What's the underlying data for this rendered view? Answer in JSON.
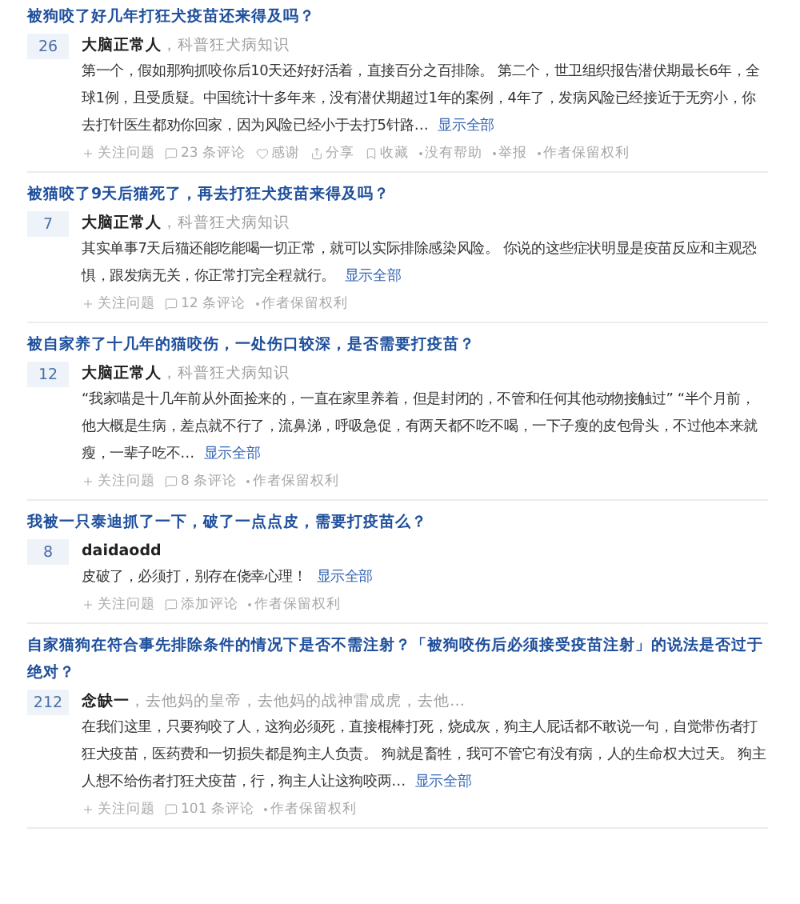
{
  "answers": [
    {
      "question": "被狗咬了好几年打狂犬疫苗还来得及吗？",
      "votes": "26",
      "author": "大脑正常人",
      "bio": "，科普狂犬病知识",
      "excerpt": "第一个，假如那狗抓咬你后10天还好好活着，直接百分之百排除。 第二个，世卫组织报告潜伏期最长6年，全球1例，且受质疑。中国统计十多年来，没有潜伏期超过1年的案例，4年了，发病风险已经接近于无穷小，你去打针医生都劝你回家，因为风险已经小于去打5针路…",
      "more": "显示全部",
      "actions": [
        {
          "kind": "plus",
          "text": "关注问题"
        },
        {
          "kind": "comment",
          "text": "23 条评论"
        },
        {
          "kind": "heart",
          "text": "感谢"
        },
        {
          "kind": "share",
          "text": "分享"
        },
        {
          "kind": "bookmark",
          "text": "收藏"
        },
        {
          "kind": "dot",
          "text": "没有帮助"
        },
        {
          "kind": "dot",
          "text": "举报"
        },
        {
          "kind": "dot",
          "text": "作者保留权利"
        }
      ]
    },
    {
      "question": "被猫咬了9天后猫死了，再去打狂犬疫苗来得及吗？",
      "votes": "7",
      "author": "大脑正常人",
      "bio": "，科普狂犬病知识",
      "excerpt": "其实单事7天后猫还能吃能喝一切正常，就可以实际排除感染风险。 你说的这些症状明显是疫苗反应和主观恐惧，跟发病无关，你正常打完全程就行。",
      "more": "显示全部",
      "actions": [
        {
          "kind": "plus",
          "text": "关注问题"
        },
        {
          "kind": "comment",
          "text": "12 条评论"
        },
        {
          "kind": "dot",
          "text": "作者保留权利"
        }
      ]
    },
    {
      "question": "被自家养了十几年的猫咬伤，一处伤口较深，是否需要打疫苗？",
      "votes": "12",
      "author": "大脑正常人",
      "bio": "，科普狂犬病知识",
      "excerpt": "“我家喵是十几年前从外面捡来的，一直在家里养着，但是封闭的，不管和任何其他动物接触过” “半个月前，他大概是生病，差点就不行了，流鼻涕，呼吸急促，有两天都不吃不喝，一下子瘦的皮包骨头，不过他本来就瘦，一辈子吃不…",
      "more": "显示全部",
      "actions": [
        {
          "kind": "plus",
          "text": "关注问题"
        },
        {
          "kind": "comment",
          "text": "8 条评论"
        },
        {
          "kind": "dot",
          "text": "作者保留权利"
        }
      ]
    },
    {
      "question": "我被一只泰迪抓了一下，破了一点点皮，需要打疫苗么？",
      "votes": "8",
      "author": "daidaodd",
      "excerpt": "皮破了，必须打，别存在侥幸心理！",
      "more": "显示全部",
      "actions": [
        {
          "kind": "plus",
          "text": "关注问题"
        },
        {
          "kind": "comment",
          "text": "添加评论"
        },
        {
          "kind": "dot",
          "text": "作者保留权利"
        }
      ]
    },
    {
      "question": "自家猫狗在符合事先排除条件的情况下是否不需注射？「被狗咬伤后必须接受疫苗注射」的说法是否过于绝对？",
      "votes": "212",
      "author": "念缺一",
      "bio": "，去他妈的皇帝，去他妈的战神雷成虎，去他…",
      "excerpt": "在我们这里，只要狗咬了人，这狗必须死，直接棍棒打死，烧成灰，狗主人屁话都不敢说一句，自觉带伤者打狂犬疫苗，医药费和一切损失都是狗主人负责。 狗就是畜牲，我可不管它有没有病，人的生命权大过天。 狗主人想不给伤者打狂犬疫苗，行，狗主人让这狗咬两…",
      "more": "显示全部",
      "actions": [
        {
          "kind": "plus",
          "text": "关注问题"
        },
        {
          "kind": "comment",
          "text": "101 条评论"
        },
        {
          "kind": "dot",
          "text": "作者保留权利"
        }
      ]
    }
  ]
}
